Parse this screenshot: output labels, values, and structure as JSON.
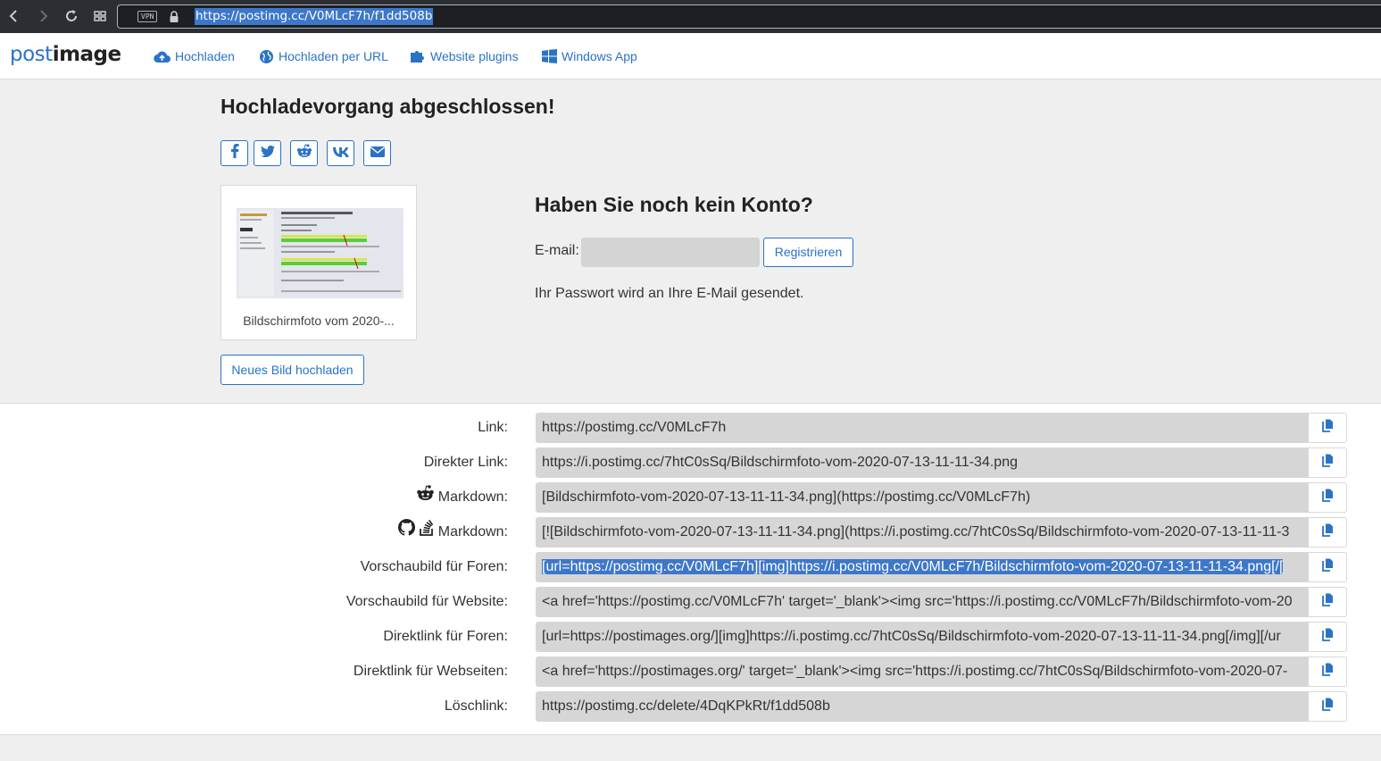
{
  "browser": {
    "vpn_badge": "VPN",
    "url": "https://postimg.cc/V0MLcF7h/f1dd508b"
  },
  "header": {
    "logo_a": "post",
    "logo_b": "image",
    "menu": [
      {
        "label": "Hochladen",
        "icon": "cloud-upload-icon"
      },
      {
        "label": "Hochladen per URL",
        "icon": "globe-icon"
      },
      {
        "label": "Website plugins",
        "icon": "puzzle-icon"
      },
      {
        "label": "Windows App",
        "icon": "windows-icon"
      }
    ]
  },
  "upload": {
    "title": "Hochladevorgang abgeschlossen!",
    "share_icons": [
      "facebook-icon",
      "twitter-icon",
      "reddit-icon",
      "vk-icon",
      "envelope-icon"
    ],
    "thumbnail_caption": "Bildschirmfoto vom 2020-...",
    "new_upload_label": "Neues Bild hochladen"
  },
  "account": {
    "title": "Haben Sie noch kein Konto?",
    "email_label": "E-mail:",
    "email_value": "",
    "register_label": "Registrieren",
    "password_note": "Ihr Passwort wird an Ihre E-Mail gesendet."
  },
  "links": [
    {
      "label": "Link:",
      "value": "https://postimg.cc/V0MLcF7h"
    },
    {
      "label": "Direkter Link:",
      "value": "https://i.postimg.cc/7htC0sSq/Bildschirmfoto-vom-2020-07-13-11-11-34.png"
    },
    {
      "label": "Markdown:",
      "value": "[Bildschirmfoto-vom-2020-07-13-11-11-34.png](https://postimg.cc/V0MLcF7h)"
    },
    {
      "label": "Markdown:",
      "value": "[![Bildschirmfoto-vom-2020-07-13-11-11-34.png](https://i.postimg.cc/7htC0sSq/Bildschirmfoto-vom-2020-07-13-11-11-3"
    },
    {
      "label": "Vorschaubild für Foren:",
      "value": "[url=https://postimg.cc/V0MLcF7h][img]https://i.postimg.cc/V0MLcF7h/Bildschirmfoto-vom-2020-07-13-11-11-34.png[/["
    },
    {
      "label": "Vorschaubild für Website:",
      "value": "<a href='https://postimg.cc/V0MLcF7h' target='_blank'><img src='https://i.postimg.cc/V0MLcF7h/Bildschirmfoto-vom-20"
    },
    {
      "label": "Direktlink für Foren:",
      "value": "[url=https://postimages.org/][img]https://i.postimg.cc/7htC0sSq/Bildschirmfoto-vom-2020-07-13-11-11-34.png[/img][/ur"
    },
    {
      "label": "Direktlink für Webseiten:",
      "value": "<a href='https://postimages.org/' target='_blank'><img src='https://i.postimg.cc/7htC0sSq/Bildschirmfoto-vom-2020-07-"
    },
    {
      "label": "Löschlink:",
      "value": "https://postimg.cc/delete/4DqKPkRt/f1dd508b"
    }
  ],
  "colors": {
    "accent": "#2a73c5",
    "selection": "#3d77c9"
  }
}
